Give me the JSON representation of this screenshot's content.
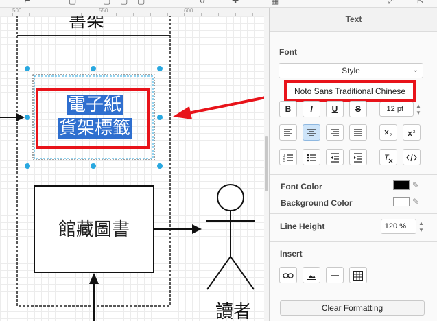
{
  "ruler": {
    "ticks": [
      "500",
      "550",
      "600"
    ]
  },
  "canvas": {
    "top_label": "書架",
    "selected_text_line1": "電子紙",
    "selected_text_line2": "貨架標籤",
    "books_label": "館藏圖書",
    "reader_label": "讀者"
  },
  "panel": {
    "title": "Text",
    "font_section": "Font",
    "style_select": "Style",
    "font_name": "Noto Sans Traditional Chinese",
    "bold_label": "B",
    "italic_label": "I",
    "underline_label": "U",
    "strike_label": "S",
    "font_size": "12 pt",
    "font_color_label": "Font Color",
    "background_color_label": "Background Color",
    "line_height_label": "Line Height",
    "line_height_value": "120 %",
    "insert_label": "Insert",
    "clear_formatting": "Clear Formatting"
  },
  "colors": {
    "accent_red": "#e8131a",
    "selection_blue": "#2f6fcf",
    "handle_blue": "#29a8e0",
    "font_color": "#000000",
    "background_color": "#ffffff",
    "active_button": "#cde4f9"
  },
  "icons": [
    "align-left-icon",
    "align-center-icon",
    "align-right-icon",
    "justify-icon",
    "subscript-icon",
    "superscript-icon",
    "numbered-list-icon",
    "bullet-list-icon",
    "outdent-icon",
    "indent-icon",
    "clear-format-icon",
    "html-icon",
    "link-icon",
    "image-icon",
    "horizontal-rule-icon",
    "table-icon",
    "pencil-icon"
  ]
}
